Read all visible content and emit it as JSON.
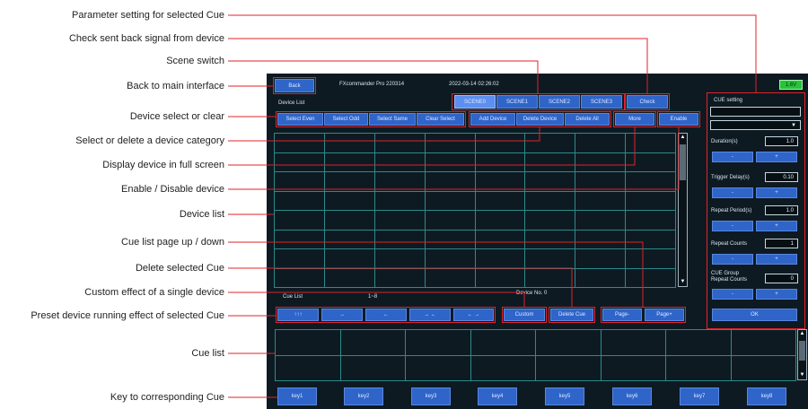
{
  "callouts": [
    "Parameter setting for selected Cue",
    "Check sent back signal from device",
    "Scene switch",
    "Back to main interface",
    "Device select or clear",
    "Select or delete a device category",
    "Display device in full screen",
    "Enable / Disable device",
    "Device list",
    "Cue list page up / down",
    "Delete selected Cue",
    "Custom effect of a single device",
    "Preset device running effect of selected Cue",
    "Cue list",
    "Key to corresponding Cue"
  ],
  "app": {
    "back_label": "Back",
    "title": "FXcommander Pro 220314",
    "datetime": "2022-03-14 02:26:02",
    "battery": "1.6V"
  },
  "scenes": [
    "SCENE0",
    "SCENE1",
    "SCENE2",
    "SCENE3"
  ],
  "check_label": "Check",
  "device_list_label": "Device List",
  "select_buttons": [
    "Select Even",
    "Select Odd",
    "Select Same",
    "Clear Select"
  ],
  "device_buttons": [
    "Add Device",
    "Delete Device",
    "Delete All"
  ],
  "more_label": "More",
  "enable_label": "Enable",
  "cue_list_label": "Cue List",
  "cue_range": "1~8",
  "device_no": "Device No. 0",
  "effect_buttons": [
    "↑↑↑",
    "→",
    "←",
    "→ ←",
    "← →"
  ],
  "custom_label": "Custom",
  "delete_cue_label": "Delete Cue",
  "page_minus": "Page-",
  "page_plus": "Page+",
  "cue_setting": {
    "title": "CUE setting",
    "duration_label": "Duration(s)",
    "duration_value": "1.0",
    "trigger_delay_label": "Trigger Delay(s)",
    "trigger_delay_value": "0.10",
    "repeat_period_label": "Repeat Period(s)",
    "repeat_period_value": "1.0",
    "repeat_counts_label": "Repeat Counts",
    "repeat_counts_value": "1",
    "group_repeat_label_1": "CUE Group",
    "group_repeat_label_2": "Repeat Counts",
    "group_repeat_value": "0",
    "minus": "-",
    "plus": "+",
    "ok_label": "OK"
  },
  "keys": [
    "key1",
    "key2",
    "key3",
    "key4",
    "key5",
    "key6",
    "key7",
    "key8"
  ],
  "colors": {
    "annotation": "#e0232b",
    "button": "#2f65c9",
    "screen": "#0e1a22",
    "grid": "#2c8a8a"
  }
}
